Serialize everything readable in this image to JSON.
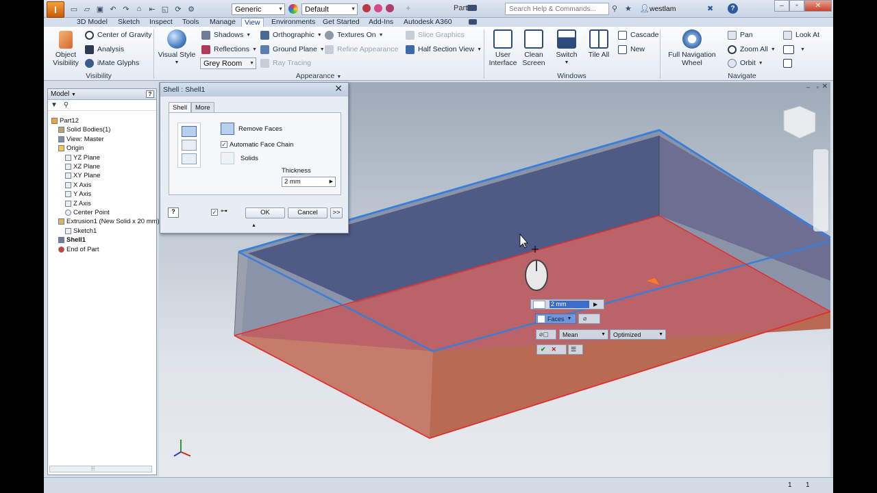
{
  "title_bar": {
    "app_logo": "I",
    "document_title": "Part12",
    "material_combo": "Generic",
    "appearance_combo": "Default",
    "search_placeholder": "Search Help & Commands...",
    "user_name": "westlam",
    "help": "?",
    "window_buttons": [
      "–",
      "▫",
      "✕"
    ]
  },
  "menu_tabs": [
    {
      "label": "3D Model",
      "active": false
    },
    {
      "label": "Sketch",
      "active": false
    },
    {
      "label": "Inspect",
      "active": false
    },
    {
      "label": "Tools",
      "active": false
    },
    {
      "label": "Manage",
      "active": false
    },
    {
      "label": "View",
      "active": true
    },
    {
      "label": "Environments",
      "active": false
    },
    {
      "label": "Get Started",
      "active": false
    },
    {
      "label": "Add-Ins",
      "active": false
    },
    {
      "label": "Autodesk A360",
      "active": false
    }
  ],
  "ribbon": {
    "visibility": {
      "panel_label": "Visibility",
      "object_visibility": "Object\nVisibility",
      "center_of_gravity": "Center of Gravity",
      "analysis": "Analysis",
      "imate_glyphs": "iMate Glyphs"
    },
    "appearance": {
      "panel_label": "Appearance",
      "visual_style": "Visual Style",
      "shadows": "Shadows",
      "reflections": "Reflections",
      "orthographic": "Orthographic",
      "ground_plane": "Ground Plane",
      "textures_on": "Textures On",
      "refine_appearance": "Refine Appearance",
      "grey_room": "Grey Room",
      "ray_tracing": "Ray Tracing",
      "slice_graphics": "Slice Graphics",
      "half_section_view": "Half Section View"
    },
    "windows": {
      "panel_label": "Windows",
      "user_interface": "User\nInterface",
      "clean_screen": "Clean\nScreen",
      "switch": "Switch",
      "tile_all": "Tile All",
      "cascade": "Cascade",
      "new": "New"
    },
    "navigate": {
      "panel_label": "Navigate",
      "full_navigation_wheel": "Full Navigation\nWheel",
      "pan": "Pan",
      "zoom_all": "Zoom All",
      "orbit": "Orbit",
      "look_at": "Look At"
    }
  },
  "browser": {
    "header": "Model",
    "tree": [
      {
        "label": "Part12",
        "indent": 0,
        "icon": "part-icon"
      },
      {
        "label": "Solid Bodies(1)",
        "indent": 1,
        "icon": "solid-bodies-icon"
      },
      {
        "label": "View: Master",
        "indent": 1,
        "icon": "view-icon"
      },
      {
        "label": "Origin",
        "indent": 1,
        "icon": "folder-icon"
      },
      {
        "label": "YZ Plane",
        "indent": 2,
        "icon": "plane-icon"
      },
      {
        "label": "XZ Plane",
        "indent": 2,
        "icon": "plane-icon"
      },
      {
        "label": "XY Plane",
        "indent": 2,
        "icon": "plane-icon"
      },
      {
        "label": "X Axis",
        "indent": 2,
        "icon": "axis-icon"
      },
      {
        "label": "Y Axis",
        "indent": 2,
        "icon": "axis-icon"
      },
      {
        "label": "Z Axis",
        "indent": 2,
        "icon": "axis-icon"
      },
      {
        "label": "Center Point",
        "indent": 2,
        "icon": "point-icon"
      },
      {
        "label": "Extrusion1 (New Solid x 20 mm)",
        "indent": 1,
        "icon": "extrusion-icon"
      },
      {
        "label": "Sketch1",
        "indent": 2,
        "icon": "sketch-icon"
      },
      {
        "label": "Shell1",
        "indent": 1,
        "icon": "shell-icon"
      },
      {
        "label": "End of Part",
        "indent": 1,
        "icon": "end-of-part-icon"
      }
    ]
  },
  "dialog": {
    "title": "Shell : Shell1",
    "tab_shell": "Shell",
    "tab_more": "More",
    "remove_faces": "Remove Faces",
    "automatic_face_chain": "Automatic Face Chain",
    "solids": "Solids",
    "thickness_label": "Thickness",
    "thickness_value": "2 mm",
    "ok": "OK",
    "cancel": "Cancel",
    "expand": ">>"
  },
  "mini_toolbar": {
    "value": "2 mm",
    "faces": "Faces",
    "mean": "Mean",
    "optimized": "Optimized"
  },
  "status_bar": {
    "count_a": "1",
    "count_b": "1"
  },
  "colors": {
    "selection_blue": "#3a7fd8",
    "selected_face_red": "#e03030",
    "ribbon_bg": "#eef2f7",
    "viewport_top": "#9eaab8"
  }
}
